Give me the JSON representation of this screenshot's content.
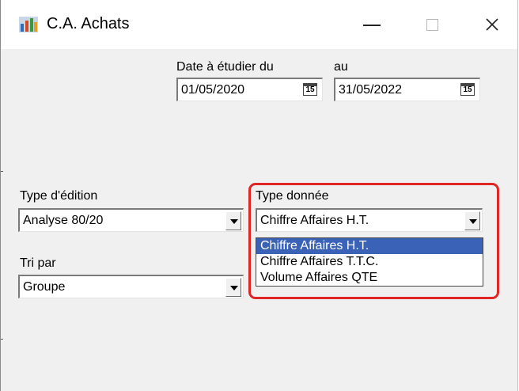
{
  "window": {
    "title": "C.A. Achats",
    "icon": "app-icon",
    "controls": {
      "minimize": "minimize-icon",
      "maximize": "maximize-icon",
      "close_glyph": "✕"
    }
  },
  "dates": {
    "from_label": "Date à étudier du",
    "from_value": "01/05/2020",
    "to_label": "au",
    "to_value": "31/05/2022",
    "calendar_glyph": "15"
  },
  "type_edition": {
    "label": "Type d'édition",
    "value": "Analyse 80/20"
  },
  "tri_par": {
    "label": "Tri par",
    "value": "Groupe"
  },
  "type_donnee": {
    "label": "Type donnée",
    "value": "Chiffre Affaires H.T.",
    "options": [
      "Chiffre Affaires H.T.",
      "Chiffre Affaires T.T.C.",
      "Volume Affaires QTE"
    ],
    "selected_index": 0
  },
  "colors": {
    "highlight": "#e02525",
    "selection": "#3a62b6"
  }
}
